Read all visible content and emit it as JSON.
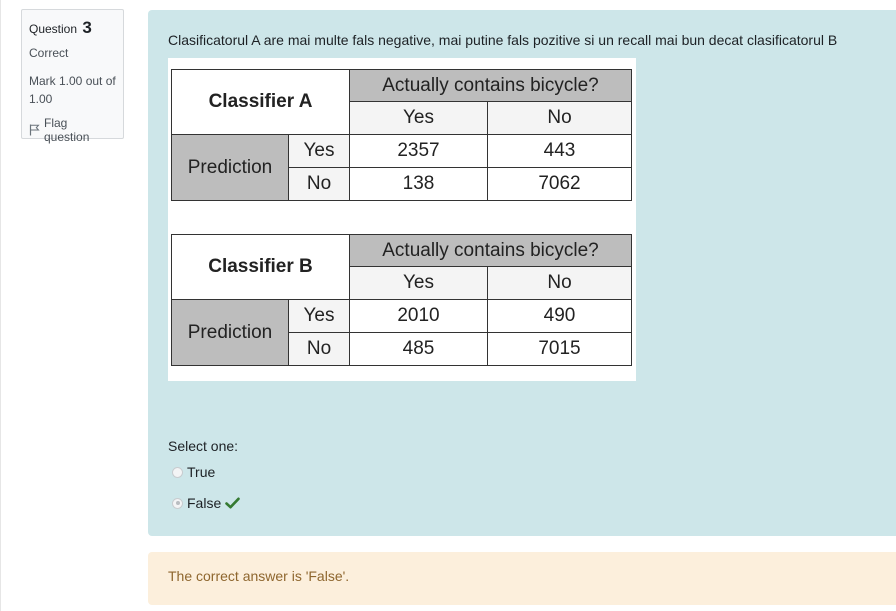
{
  "question_info": {
    "question_label": "Question",
    "question_number": "3",
    "state": "Correct",
    "grade": "Mark 1.00 out of 1.00",
    "flag_label": "Flag question"
  },
  "question": {
    "text": "Clasificatorul A are mai multe fals negative, mai putine fals pozitive si un recall mai bun decat clasificatorul B",
    "tables": [
      {
        "name": "Classifier A",
        "header": "Actually contains bicycle?",
        "columns": [
          "Yes",
          "No"
        ],
        "row_group": "Prediction",
        "rows": [
          {
            "label": "Yes",
            "values": [
              "2357",
              "443"
            ]
          },
          {
            "label": "No",
            "values": [
              "138",
              "7062"
            ]
          }
        ]
      },
      {
        "name": "Classifier B",
        "header": "Actually contains bicycle?",
        "columns": [
          "Yes",
          "No"
        ],
        "row_group": "Prediction",
        "rows": [
          {
            "label": "Yes",
            "values": [
              "2010",
              "490"
            ]
          },
          {
            "label": "No",
            "values": [
              "485",
              "7015"
            ]
          }
        ]
      }
    ],
    "prompt": "Select one:",
    "options": [
      {
        "label": "True",
        "selected": false
      },
      {
        "label": "False",
        "selected": true,
        "correct": true
      }
    ]
  },
  "feedback": {
    "right_answer": "The correct answer is 'False'."
  },
  "colors": {
    "content_bg": "#cde6e9",
    "feedback_bg": "#fcefdc",
    "feedback_text": "#8e662e",
    "correct_check": "#357a32"
  }
}
